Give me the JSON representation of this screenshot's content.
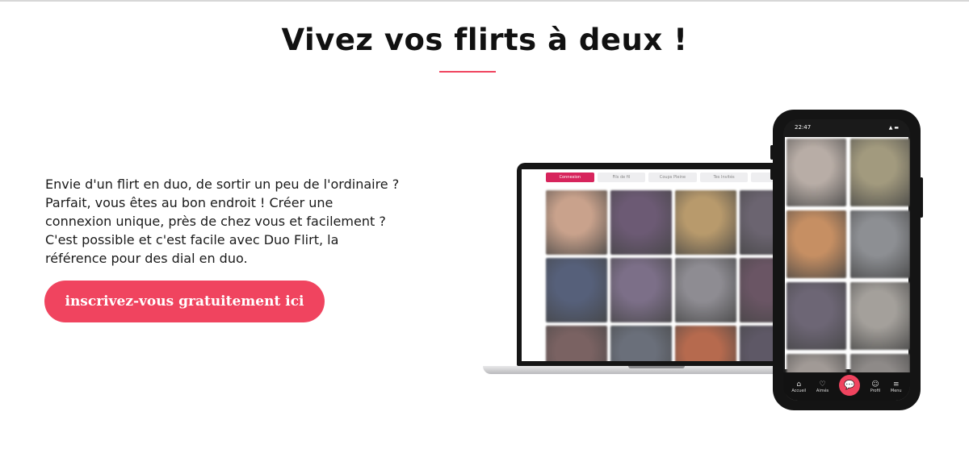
{
  "hero": {
    "title": "Vivez vos flirts à deux !",
    "intro_lines": [
      "Envie d'un flirt en duo, de sortir un peu de l'ordinaire ?",
      "Parfait, vous êtes au bon endroit ! Créer une",
      "connexion unique, près de chez vous et facilement ?",
      "C'est possible et c'est facile avec Duo Flirt, la",
      "référence pour des dial en duo."
    ],
    "cta_label": "inscrivez-vous gratuitement ici"
  },
  "colors": {
    "accent": "#f0445f",
    "tab_active": "#d7245c"
  },
  "laptop": {
    "tabs": [
      "Connexion",
      "Fils de fil",
      "Coups Pleine",
      "Tes Invités",
      "Tu"
    ],
    "active_tab": 0,
    "photos": [
      "#c9a28c",
      "#6c5a74",
      "#b89a6c",
      "#6b6470",
      "#56607a",
      "#7c6f88",
      "#8e8c92",
      "#6a5564",
      "#7a6262",
      "#6a6f7a",
      "#b66a4e",
      "#5e5866"
    ]
  },
  "phone": {
    "time": "22:47",
    "status_icons": "▲ ▬",
    "photos": [
      "#b8ada6",
      "#a29a7e",
      "#c68f63",
      "#8d8f93",
      "#6d6675",
      "#a4a09b",
      "#a19a96",
      "#8e8a88"
    ],
    "nav": [
      {
        "icon": "home-icon",
        "glyph": "⌂",
        "label": "Accueil"
      },
      {
        "icon": "heart-icon",
        "glyph": "♡",
        "label": "Aimés"
      },
      {
        "icon": "chat-icon",
        "glyph": "💬",
        "label": ""
      },
      {
        "icon": "user-icon",
        "glyph": "☺",
        "label": "Profil"
      },
      {
        "icon": "menu-icon",
        "glyph": "≡",
        "label": "Menu"
      }
    ]
  }
}
